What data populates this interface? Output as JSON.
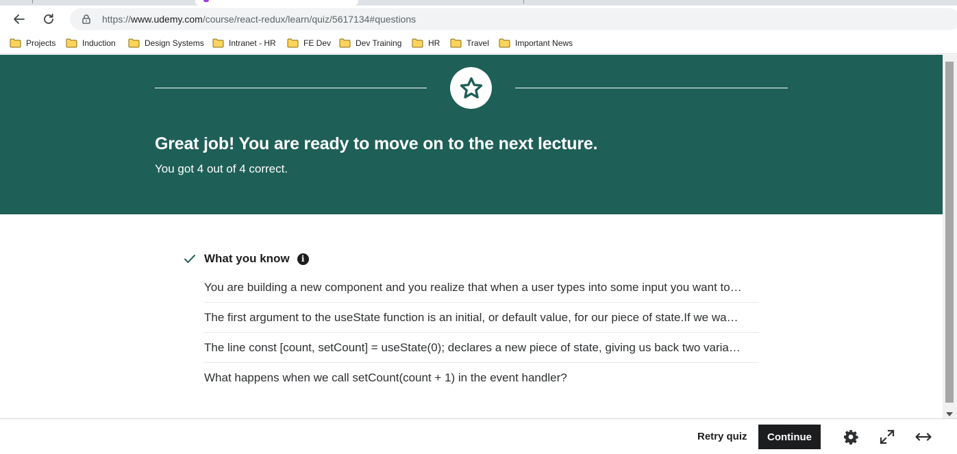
{
  "browser": {
    "url_prefix": "https://",
    "url_domain": "www.udemy.com",
    "url_path": "/course/react-redux/learn/quiz/5617134#questions",
    "icons": {
      "back": "back-arrow-icon",
      "reload": "reload-icon",
      "lock": "lock-icon"
    }
  },
  "bookmarks": [
    {
      "label": "Projects"
    },
    {
      "label": "Induction"
    },
    {
      "label": "Design Systems"
    },
    {
      "label": "Intranet - HR"
    },
    {
      "label": "FE Dev"
    },
    {
      "label": "Dev Training"
    },
    {
      "label": "HR"
    },
    {
      "label": "Travel"
    },
    {
      "label": "Important News"
    }
  ],
  "result": {
    "title": "Great job! You are ready to move on to the next lecture.",
    "score_text": "You got 4 out of 4 correct.",
    "banner_color": "#1e5f57",
    "icon": "star-icon"
  },
  "what_you_know": {
    "heading": "What you know",
    "questions": [
      "You are building a new component and you realize that when a user types into some input you want to…",
      "The first argument to the useState function is an initial, or default value, for our piece of state.If we wa…",
      "The line const [count, setCount] = useState(0); declares a new piece of state, giving us back two varia…",
      "What happens when we call setCount(count + 1) in the event handler?"
    ]
  },
  "footer": {
    "retry_label": "Retry quiz",
    "continue_label": "Continue",
    "icons": [
      "gear-icon",
      "expand-icon",
      "wide-toggle-icon"
    ]
  }
}
